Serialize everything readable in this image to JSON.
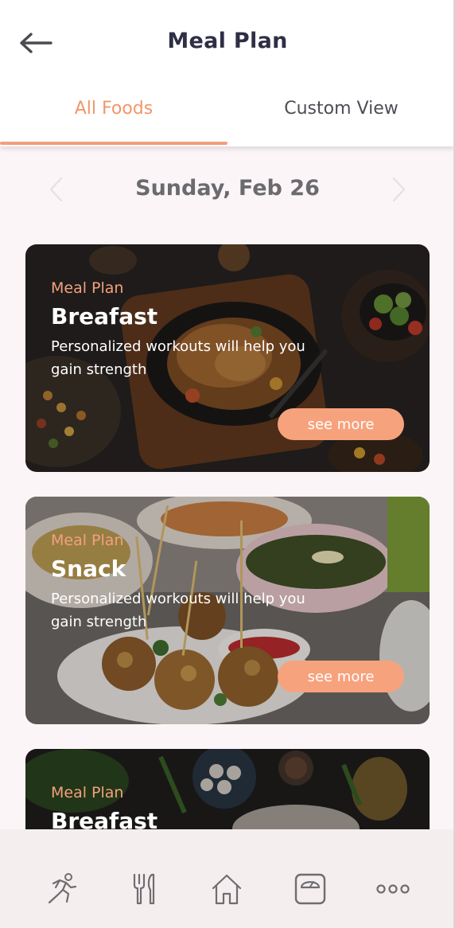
{
  "header": {
    "title": "Meal Plan",
    "tabs": [
      {
        "label": "All Foods",
        "active": true
      },
      {
        "label": "Custom View",
        "active": false
      }
    ]
  },
  "date": {
    "label": "Sunday, Feb 26"
  },
  "cards": [
    {
      "eyebrow": "Meal Plan",
      "title": "Breafast",
      "description": "Personalized workouts will help you gain strength",
      "button": "see more"
    },
    {
      "eyebrow": "Meal Plan",
      "title": "Snack",
      "description": "Personalized workouts will help you gain strength",
      "button": "see more"
    },
    {
      "eyebrow": "Meal Plan",
      "title": "Breafast"
    }
  ],
  "bottom_nav": [
    "running-icon",
    "fork-knife-icon",
    "home-icon",
    "scale-icon",
    "more-icon"
  ],
  "colors": {
    "accent": "#f6a27d",
    "title": "#2e2e45",
    "nav_bg": "#f5eeee"
  }
}
